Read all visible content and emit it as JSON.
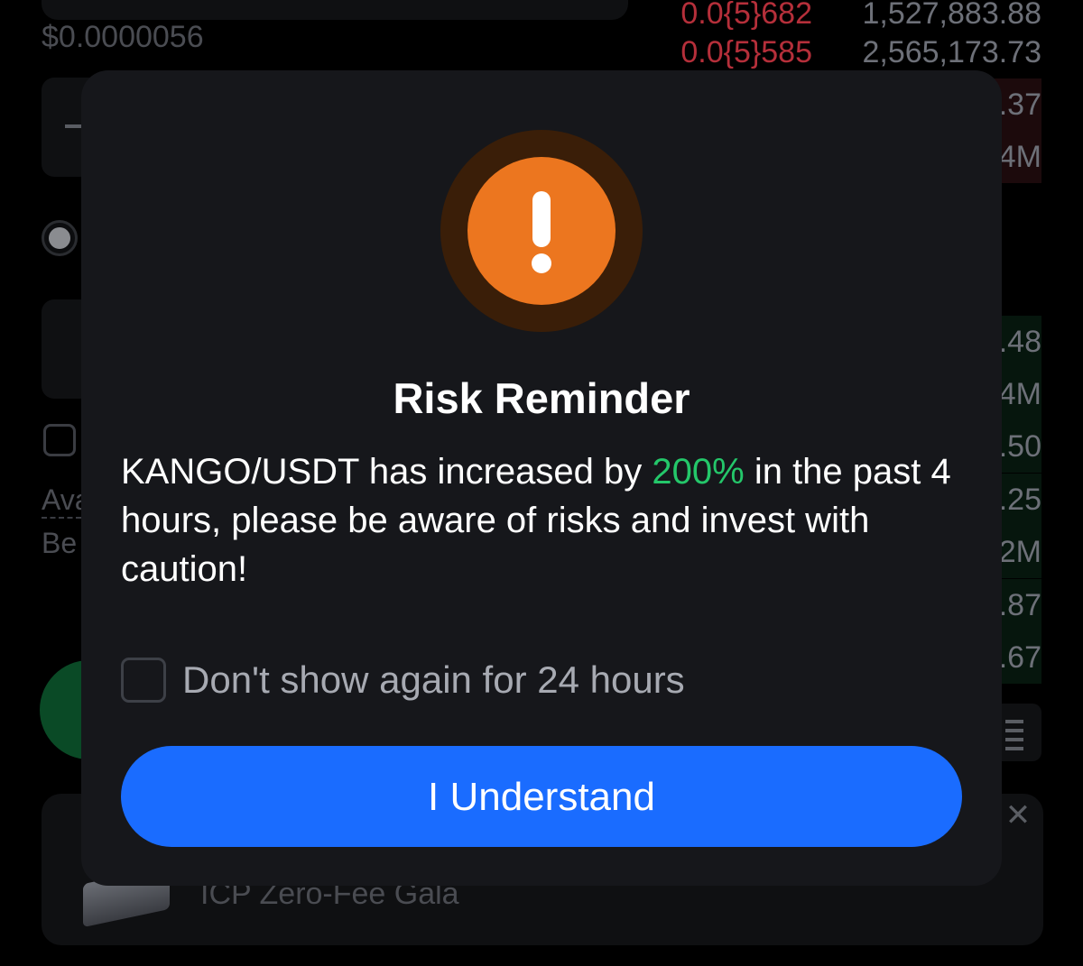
{
  "background": {
    "last_price": "$0.0000056",
    "order_book": [
      {
        "price": "0.0{5}682",
        "amount": "1,527,883.88"
      },
      {
        "price": "0.0{5}585",
        "amount": "2,565,173.73"
      }
    ],
    "partial_amounts_ask": [
      ".37",
      "4M"
    ],
    "partial_amounts_bid": [
      ".48",
      "4M",
      ".50",
      ".25",
      "2M",
      ".87",
      ".67"
    ],
    "label_a": "Ava",
    "label_b": "Be",
    "banner_text": "ICP Zero-Fee Gala",
    "banner_close_glyph": "✕"
  },
  "modal": {
    "title": "Risk Reminder",
    "message_prefix": "KANGO/USDT has increased by ",
    "message_highlight": "200%",
    "message_suffix": " in the past 4 hours, please be aware of risks and invest with caution!",
    "dont_show_label": "Don't show again for 24 hours",
    "dont_show_checked": false,
    "confirm_label": "I Understand",
    "icon": "exclamation-icon"
  },
  "colors": {
    "accent_blue": "#1a6cff",
    "warning_orange": "#ec761f",
    "positive_green": "#24c76a",
    "ask_red": "#b52f3a"
  }
}
